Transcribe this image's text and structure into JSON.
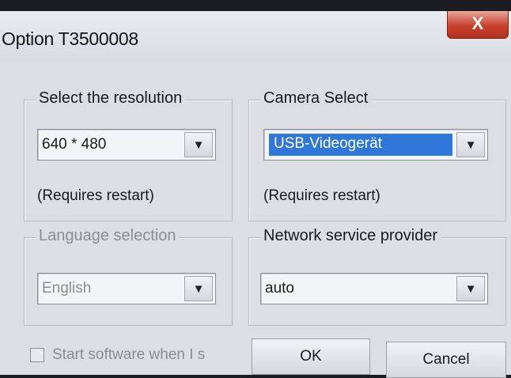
{
  "window": {
    "title": "Option T3500008",
    "close_label": "X"
  },
  "groups": {
    "resolution": {
      "legend": "Select the resolution",
      "value": "640 * 480",
      "note": "(Requires restart)"
    },
    "camera": {
      "legend": "Camera Select",
      "value": "USB-Videogerät",
      "note": "(Requires restart)"
    },
    "language": {
      "legend": "Language selection",
      "value": "English"
    },
    "network": {
      "legend": "Network service provider",
      "value": "auto"
    }
  },
  "footer": {
    "startup_label": "Start software when I s",
    "ok_label": "OK",
    "cancel_label": "Cancel"
  },
  "icons": {
    "dropdown": "chevron-down-icon",
    "close": "close-icon"
  }
}
